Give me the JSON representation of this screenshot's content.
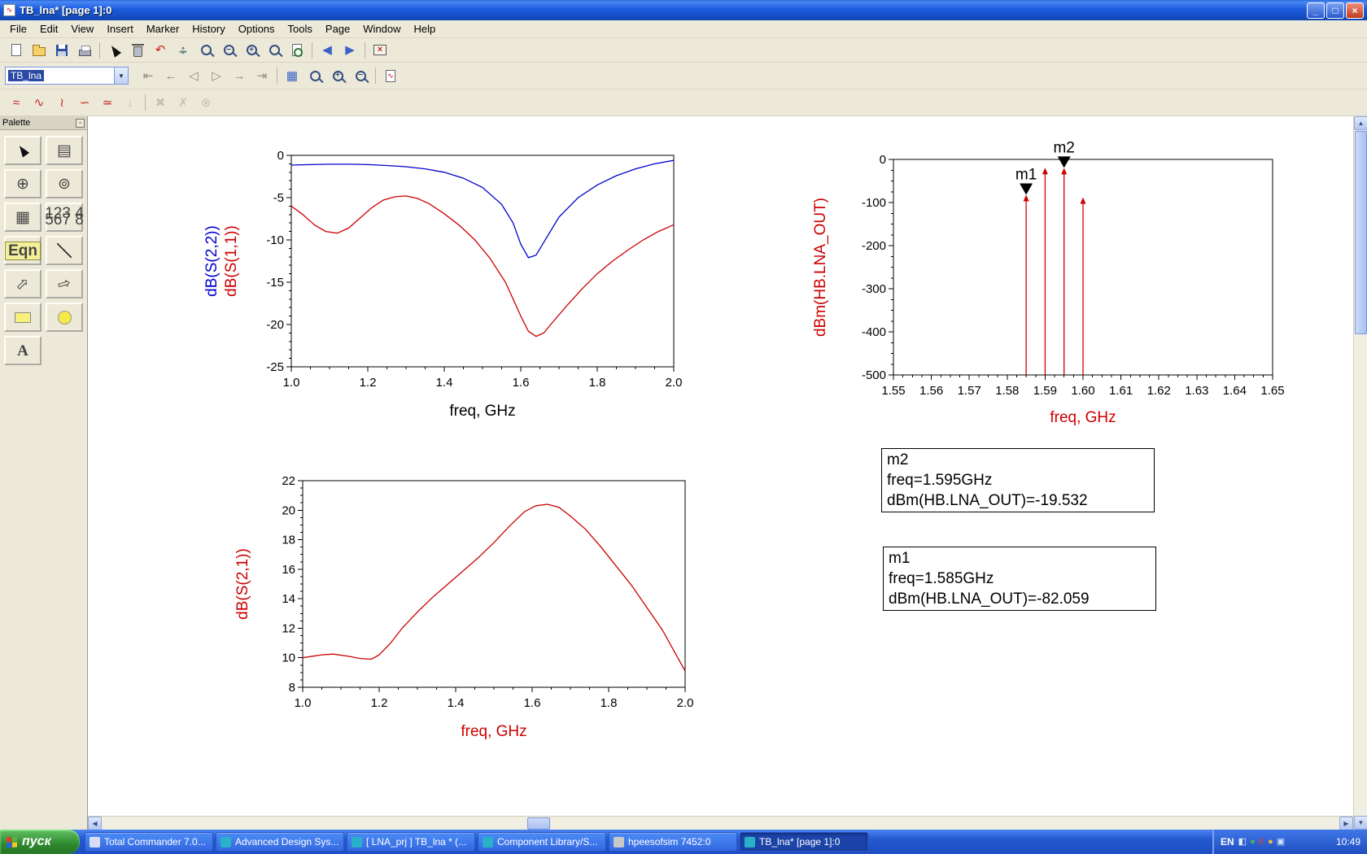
{
  "window": {
    "title": "TB_lna* [page 1]:0",
    "controls": {
      "minimize": "_",
      "maximize": "□",
      "close": "×"
    }
  },
  "menu": {
    "items": [
      "File",
      "Edit",
      "View",
      "Insert",
      "Marker",
      "History",
      "Options",
      "Tools",
      "Page",
      "Window",
      "Help"
    ]
  },
  "toolbar_main": {
    "buttons": [
      {
        "name": "new",
        "icon": "page"
      },
      {
        "name": "open",
        "icon": "folder"
      },
      {
        "name": "save",
        "icon": "floppy"
      },
      {
        "name": "print",
        "icon": "printer"
      },
      {
        "sep": true
      },
      {
        "name": "select-pointer",
        "icon": "cursor"
      },
      {
        "name": "delete",
        "icon": "trash"
      },
      {
        "name": "undo",
        "icon": "glyph",
        "glyph": "↶",
        "color": "#cc2222"
      },
      {
        "name": "pan",
        "icon": "move"
      },
      {
        "name": "zoom-area",
        "icon": "zoom",
        "glyph": ""
      },
      {
        "name": "zoom-out",
        "icon": "zoom",
        "glyph": "−"
      },
      {
        "name": "zoom-in",
        "icon": "zoom",
        "glyph": "+"
      },
      {
        "name": "zoom-full",
        "icon": "zoom",
        "glyph": ""
      },
      {
        "name": "view-all",
        "icon": "zoompage"
      },
      {
        "sep": true
      },
      {
        "name": "back",
        "icon": "glyph",
        "glyph": "◀",
        "color": "#3a62c8"
      },
      {
        "name": "forward",
        "icon": "glyph",
        "glyph": "▶",
        "color": "#3a62c8"
      },
      {
        "sep": true
      },
      {
        "name": "close-window",
        "icon": "xbox",
        "glyph": "×"
      }
    ]
  },
  "toolbar_page": {
    "dataset_value": "TB_lna",
    "buttons": [
      {
        "name": "first-sweep",
        "icon": "glyph",
        "glyph": "⇤",
        "disabled": true
      },
      {
        "name": "prev-sweep",
        "icon": "glyph",
        "glyph": "←",
        "disabled": true
      },
      {
        "name": "step-back",
        "icon": "glyph",
        "glyph": "◁",
        "disabled": true
      },
      {
        "name": "step-forward",
        "icon": "glyph",
        "glyph": "▷",
        "disabled": true
      },
      {
        "name": "next-sweep",
        "icon": "glyph",
        "glyph": "→",
        "disabled": true
      },
      {
        "name": "last-sweep",
        "icon": "glyph",
        "glyph": "⇥",
        "disabled": true
      },
      {
        "sep": true
      },
      {
        "name": "tile-view",
        "icon": "glyph",
        "glyph": "▦",
        "color": "#3a62c8"
      },
      {
        "name": "zoom-window",
        "icon": "zoom",
        "glyph": ""
      },
      {
        "name": "zoom-in-view",
        "icon": "zoom",
        "glyph": "+"
      },
      {
        "name": "zoom-out-view",
        "icon": "zoom",
        "glyph": "−"
      },
      {
        "sep": true
      },
      {
        "name": "new-chart-page",
        "icon": "chartpage",
        "glyph": "∿"
      }
    ]
  },
  "toolbar_plot": {
    "buttons": [
      {
        "name": "insert-rect-plot",
        "icon": "glyph",
        "glyph": "≈",
        "color": "#cc2222"
      },
      {
        "name": "insert-polar-plot",
        "icon": "glyph",
        "glyph": "∿",
        "color": "#cc2222"
      },
      {
        "name": "insert-smith-plot",
        "icon": "glyph",
        "glyph": "≀",
        "color": "#cc2222"
      },
      {
        "name": "insert-list-plot",
        "icon": "glyph",
        "glyph": "∽",
        "color": "#cc2222"
      },
      {
        "name": "insert-stack-plot",
        "icon": "glyph",
        "glyph": "≃",
        "color": "#cc2222"
      },
      {
        "name": "trace-down",
        "icon": "glyph",
        "glyph": "↓",
        "color": "#888",
        "disabled": true
      },
      {
        "sep": true
      },
      {
        "name": "delete-trace",
        "icon": "glyph",
        "glyph": "✖",
        "color": "#888",
        "disabled": true
      },
      {
        "name": "marker-x",
        "icon": "glyph",
        "glyph": "✗",
        "color": "#888",
        "disabled": true
      },
      {
        "name": "marker-xy",
        "icon": "glyph",
        "glyph": "⊗",
        "color": "#888",
        "disabled": true
      }
    ]
  },
  "palette": {
    "title": "Palette",
    "items": [
      {
        "name": "palette-pointer",
        "icon": "cursor"
      },
      {
        "name": "palette-list",
        "icon": "glyph",
        "glyph": "▤"
      },
      {
        "name": "palette-polar-plot",
        "icon": "glyph",
        "glyph": "⊕"
      },
      {
        "name": "palette-smith-chart",
        "icon": "glyph",
        "glyph": "⊚"
      },
      {
        "name": "palette-grid-plot",
        "icon": "glyph",
        "glyph": "▦"
      },
      {
        "name": "palette-list-values",
        "icon": "minitable",
        "text": "123 4\n567 8"
      },
      {
        "name": "palette-equation",
        "icon": "badge",
        "text": "Eqn"
      },
      {
        "name": "palette-line",
        "icon": "line"
      },
      {
        "name": "palette-arrow",
        "icon": "arrow",
        "glyph": "⇨"
      },
      {
        "name": "palette-arrow-2",
        "icon": "arrow2",
        "glyph": "⇨"
      },
      {
        "name": "palette-rectangle",
        "icon": "rect"
      },
      {
        "name": "palette-circle",
        "icon": "circle"
      },
      {
        "name": "palette-text",
        "icon": "text",
        "glyph": "A"
      }
    ]
  },
  "chart_data": [
    {
      "id": "sparams",
      "type": "line",
      "title": "",
      "xlabel": "freq, GHz",
      "xlabel_color": "#000000",
      "ylabels": [
        {
          "text": "dB(S(2,2))",
          "color": "#0000cc"
        },
        {
          "text": "dB(S(1,1))",
          "color": "#cc0000"
        }
      ],
      "xlim": [
        1.0,
        2.0
      ],
      "ylim": [
        -25,
        0
      ],
      "xticks": [
        1.0,
        1.2,
        1.4,
        1.6,
        1.8,
        2.0
      ],
      "xtick_labels": [
        "1.0",
        "1.2",
        "1.4",
        "1.6",
        "1.8",
        "2.0"
      ],
      "xminor": 0.05,
      "yticks": [
        0,
        -5,
        -10,
        -15,
        -20,
        -25
      ],
      "ytick_labels": [
        "0",
        "-5",
        "-10",
        "-15",
        "-20",
        "-25"
      ],
      "yminor": 1,
      "grid": false,
      "legend": false,
      "series": [
        {
          "name": "dB(S(2,2))",
          "color": "#0000cc",
          "points": [
            [
              1.0,
              -1.15
            ],
            [
              1.05,
              -1.1
            ],
            [
              1.1,
              -1.05
            ],
            [
              1.15,
              -1.05
            ],
            [
              1.2,
              -1.1
            ],
            [
              1.25,
              -1.2
            ],
            [
              1.3,
              -1.35
            ],
            [
              1.35,
              -1.6
            ],
            [
              1.4,
              -2.0
            ],
            [
              1.45,
              -2.7
            ],
            [
              1.5,
              -3.8
            ],
            [
              1.55,
              -5.8
            ],
            [
              1.58,
              -8.0
            ],
            [
              1.6,
              -10.5
            ],
            [
              1.62,
              -12.1
            ],
            [
              1.64,
              -11.8
            ],
            [
              1.66,
              -10.3
            ],
            [
              1.7,
              -7.3
            ],
            [
              1.75,
              -5.0
            ],
            [
              1.8,
              -3.5
            ],
            [
              1.85,
              -2.4
            ],
            [
              1.9,
              -1.6
            ],
            [
              1.95,
              -1.0
            ],
            [
              2.0,
              -0.6
            ]
          ]
        },
        {
          "name": "dB(S(1,1))",
          "color": "#cc0000",
          "points": [
            [
              1.0,
              -6.0
            ],
            [
              1.03,
              -7.0
            ],
            [
              1.06,
              -8.2
            ],
            [
              1.09,
              -9.0
            ],
            [
              1.12,
              -9.2
            ],
            [
              1.15,
              -8.6
            ],
            [
              1.18,
              -7.4
            ],
            [
              1.21,
              -6.2
            ],
            [
              1.24,
              -5.3
            ],
            [
              1.27,
              -4.9
            ],
            [
              1.3,
              -4.8
            ],
            [
              1.33,
              -5.1
            ],
            [
              1.36,
              -5.7
            ],
            [
              1.4,
              -6.9
            ],
            [
              1.44,
              -8.3
            ],
            [
              1.48,
              -10.0
            ],
            [
              1.52,
              -12.2
            ],
            [
              1.56,
              -15.0
            ],
            [
              1.6,
              -19.0
            ],
            [
              1.62,
              -20.8
            ],
            [
              1.64,
              -21.4
            ],
            [
              1.66,
              -21.0
            ],
            [
              1.68,
              -19.9
            ],
            [
              1.72,
              -17.8
            ],
            [
              1.76,
              -15.8
            ],
            [
              1.8,
              -14.0
            ],
            [
              1.84,
              -12.5
            ],
            [
              1.88,
              -11.2
            ],
            [
              1.92,
              -10.0
            ],
            [
              1.96,
              -9.0
            ],
            [
              2.0,
              -8.2
            ]
          ]
        }
      ]
    },
    {
      "id": "spectrum",
      "type": "stem",
      "title": "",
      "xlabel": "freq, GHz",
      "xlabel_color": "#cc0000",
      "ylabels": [
        {
          "text": "dBm(HB.LNA_OUT)",
          "color": "#cc0000"
        }
      ],
      "xlim": [
        1.55,
        1.65
      ],
      "ylim": [
        -500,
        0
      ],
      "xticks": [
        1.55,
        1.56,
        1.57,
        1.58,
        1.59,
        1.6,
        1.61,
        1.62,
        1.63,
        1.64,
        1.65
      ],
      "xtick_labels": [
        "1.55",
        "1.56",
        "1.57",
        "1.58",
        "1.59",
        "1.60",
        "1.61",
        "1.62",
        "1.63",
        "1.64",
        "1.65"
      ],
      "xminor": 0.0025,
      "yticks": [
        0,
        -100,
        -200,
        -300,
        -400,
        -500
      ],
      "ytick_labels": [
        "0",
        "-100",
        "-200",
        "-300",
        "-400",
        "-500"
      ],
      "yminor": 25,
      "grid": false,
      "stem_color": "#cc0000",
      "stems": [
        {
          "x": 1.585,
          "y": -82.059
        },
        {
          "x": 1.59,
          "y": -19.3
        },
        {
          "x": 1.595,
          "y": -19.532
        },
        {
          "x": 1.6,
          "y": -88.0
        }
      ],
      "markers": [
        {
          "name": "m1",
          "x": 1.585,
          "y": -82.059
        },
        {
          "name": "m2",
          "x": 1.595,
          "y": -19.532
        }
      ]
    },
    {
      "id": "s21",
      "type": "line",
      "title": "",
      "xlabel": "freq, GHz",
      "xlabel_color": "#cc0000",
      "ylabels": [
        {
          "text": "dB(S(2,1))",
          "color": "#cc0000"
        }
      ],
      "xlim": [
        1.0,
        2.0
      ],
      "ylim": [
        8,
        22
      ],
      "xticks": [
        1.0,
        1.2,
        1.4,
        1.6,
        1.8,
        2.0
      ],
      "xtick_labels": [
        "1.0",
        "1.2",
        "1.4",
        "1.6",
        "1.8",
        "2.0"
      ],
      "xminor": 0.05,
      "yticks": [
        8,
        10,
        12,
        14,
        16,
        18,
        20,
        22
      ],
      "ytick_labels": [
        "8",
        "10",
        "12",
        "14",
        "16",
        "18",
        "20",
        "22"
      ],
      "yminor": 0.5,
      "grid": false,
      "series": [
        {
          "name": "dB(S(2,1))",
          "color": "#cc0000",
          "points": [
            [
              1.0,
              10.0
            ],
            [
              1.05,
              10.2
            ],
            [
              1.08,
              10.25
            ],
            [
              1.12,
              10.1
            ],
            [
              1.15,
              9.95
            ],
            [
              1.18,
              9.9
            ],
            [
              1.2,
              10.2
            ],
            [
              1.23,
              11.0
            ],
            [
              1.26,
              12.0
            ],
            [
              1.3,
              13.1
            ],
            [
              1.34,
              14.1
            ],
            [
              1.38,
              15.0
            ],
            [
              1.42,
              15.9
            ],
            [
              1.46,
              16.8
            ],
            [
              1.5,
              17.8
            ],
            [
              1.54,
              18.9
            ],
            [
              1.58,
              19.9
            ],
            [
              1.61,
              20.3
            ],
            [
              1.64,
              20.4
            ],
            [
              1.67,
              20.2
            ],
            [
              1.7,
              19.6
            ],
            [
              1.74,
              18.7
            ],
            [
              1.78,
              17.5
            ],
            [
              1.82,
              16.2
            ],
            [
              1.86,
              14.9
            ],
            [
              1.9,
              13.4
            ],
            [
              1.94,
              11.9
            ],
            [
              1.97,
              10.5
            ],
            [
              2.0,
              9.1
            ]
          ]
        }
      ]
    }
  ],
  "marker_boxes": [
    {
      "name": "m2",
      "lines": [
        "m2",
        "freq=1.595GHz",
        "dBm(HB.LNA_OUT)=-19.532"
      ]
    },
    {
      "name": "m1",
      "lines": [
        "m1",
        "freq=1.585GHz",
        "dBm(HB.LNA_OUT)=-82.059"
      ]
    }
  ],
  "taskbar": {
    "start_label": "пуск",
    "items": [
      {
        "label": "Total Commander 7.0...",
        "icon_color": "#d8def5",
        "active": false
      },
      {
        "label": "Advanced Design Sys...",
        "icon_color": "#2ab0c8",
        "active": false
      },
      {
        "label": "[ LNA_prj ] TB_lna * (...",
        "icon_color": "#2ab0c8",
        "active": false
      },
      {
        "label": "Component Library/S...",
        "icon_color": "#2ab0c8",
        "active": false
      },
      {
        "label": "hpeesofsim 7452:0",
        "icon_color": "#c8c8c8",
        "active": false
      },
      {
        "label": "TB_lna* [page 1]:0",
        "icon_color": "#2ab0c8",
        "active": true
      }
    ],
    "tray": {
      "lang": "EN",
      "icons": [
        {
          "glyph": "◧",
          "color": "#e6ecff"
        },
        {
          "glyph": "●",
          "color": "#49b849"
        },
        {
          "glyph": "K",
          "color": "#e04330"
        },
        {
          "glyph": "●",
          "color": "#f0b840"
        },
        {
          "glyph": "▣",
          "color": "#cfe2ff"
        }
      ],
      "time": "10:49"
    }
  }
}
